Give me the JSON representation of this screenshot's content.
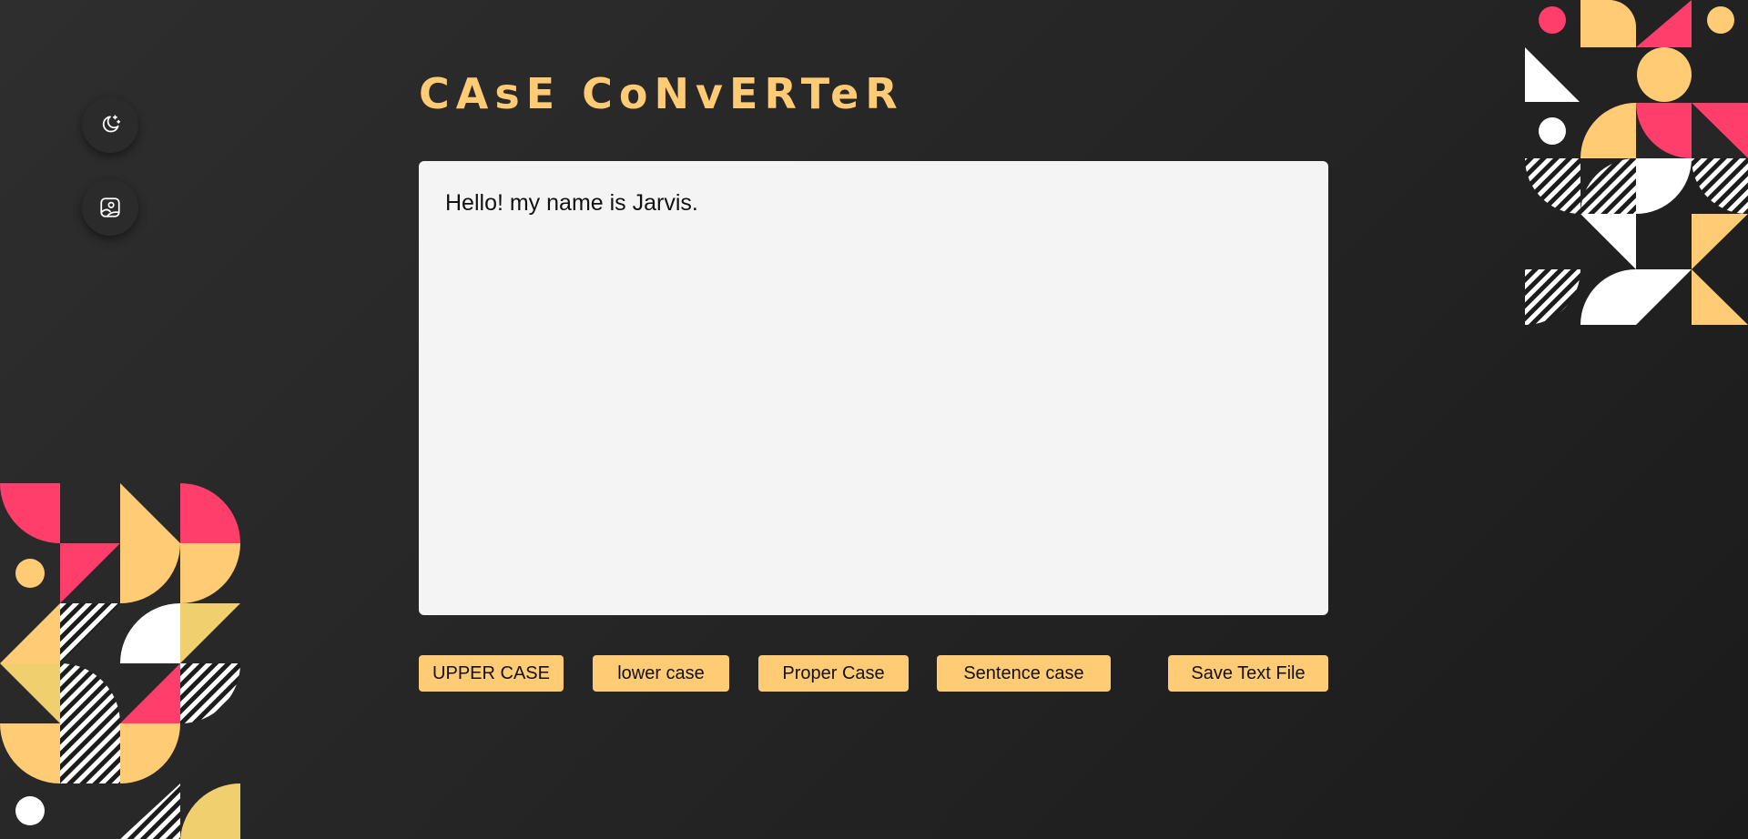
{
  "app": {
    "title": "CAsE CoNvERTeR"
  },
  "sidebar": {
    "theme_icon": "moon-stars-icon",
    "background_icon": "image-icon"
  },
  "editor": {
    "value": "Hello! my name is Jarvis."
  },
  "actions": {
    "upper_label": "UPPER CASE",
    "lower_label": "lower case",
    "proper_label": "Proper Case",
    "sentence_label": "Sentence case",
    "save_label": "Save Text File"
  },
  "colors": {
    "accent": "#ffcb74",
    "pink": "#ff3e6c",
    "background": "#262626",
    "editor_bg": "#f4f4f4",
    "text": "#111111",
    "white": "#ffffff"
  }
}
